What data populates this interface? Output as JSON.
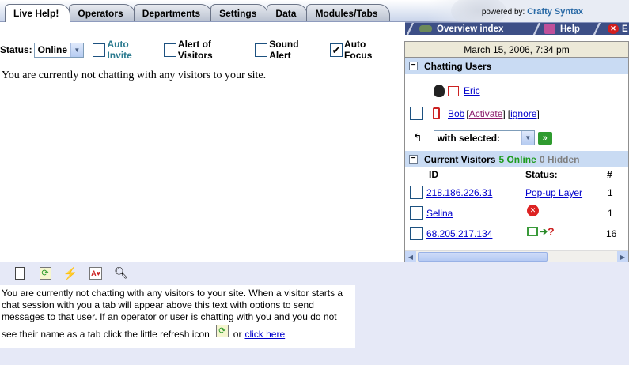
{
  "tabs": [
    {
      "label": "Live Help!",
      "active": true
    },
    {
      "label": "Operators"
    },
    {
      "label": "Departments"
    },
    {
      "label": "Settings"
    },
    {
      "label": "Data"
    },
    {
      "label": "Modules/Tabs"
    }
  ],
  "powered": {
    "prefix": "powered by:",
    "brand": "Crafty Syntax"
  },
  "subnav": {
    "overview": "Overview index",
    "help": "Help",
    "exit": "E"
  },
  "status": {
    "label": "Status:",
    "value": "Online",
    "checks": [
      {
        "label": "Auto Invite",
        "checked": false
      },
      {
        "label": "Alert of Visitors",
        "checked": false
      },
      {
        "label": "Sound Alert",
        "checked": false
      },
      {
        "label": "Auto Focus",
        "checked": true
      }
    ]
  },
  "main_message": "You are currently not chatting with any visitors to your site.",
  "panel": {
    "date": "March 15, 2006, 7:34 pm",
    "chatting_title": "Chatting Users",
    "users": [
      {
        "name": "Eric"
      },
      {
        "name": "Bob",
        "activate": "Activate",
        "ignore": "ignore"
      }
    ],
    "with_selected": "with selected:",
    "visitors_title": "Current Visitors",
    "online_count": "5 Online",
    "hidden_count": "0 Hidden",
    "columns": {
      "id": "ID",
      "status": "Status:",
      "count": "#"
    },
    "visitors": [
      {
        "id": "218.186.226.31",
        "status": "Pop-up Layer",
        "count": "1"
      },
      {
        "id": "Selina",
        "status": "",
        "count": "1"
      },
      {
        "id": "68.205.217.134",
        "status": "",
        "count": "16"
      }
    ]
  },
  "help_text": "You are currently not chatting with any visitors to your site. When a visitor starts a chat session with you a tab will appear above this text with options to send messages to that user. If an operator or user is chatting with you and you do not",
  "help_text2": "see their name as a tab click the little refresh icon",
  "help_or": "or",
  "help_link": "click here"
}
